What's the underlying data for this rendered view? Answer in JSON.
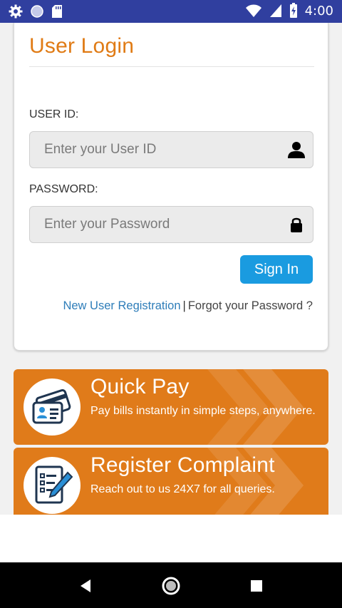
{
  "status_bar": {
    "time": "4:00",
    "icons": [
      "gear-icon",
      "circle-icon",
      "sd-card-icon",
      "wifi-icon",
      "signal-icon",
      "battery-icon"
    ]
  },
  "login": {
    "title": "User Login",
    "user_id_label": "USER ID:",
    "user_id_placeholder": "Enter your User ID",
    "user_id_value": "",
    "password_label": "PASSWORD:",
    "password_placeholder": "Enter your Password",
    "password_value": "",
    "sign_in_label": "Sign In",
    "new_user_link": "New User Registration",
    "separator": "|",
    "forgot_link": "Forgot your Password ?"
  },
  "promos": [
    {
      "title": "Quick Pay",
      "description": "Pay bills instantly in simple steps, anywhere.",
      "icon": "card-payment-icon"
    },
    {
      "title": "Register Complaint",
      "description": "Reach out to us 24X7 for all queries.",
      "icon": "checklist-pen-icon"
    }
  ],
  "nav_bar": {
    "buttons": [
      "back-icon",
      "home-icon",
      "recents-icon"
    ]
  },
  "colors": {
    "status_bar": "#303f9f",
    "title_orange": "#e07b15",
    "promo_orange": "#e07b1a",
    "sign_in_blue": "#1a9be0",
    "link_blue": "#2e7db9"
  }
}
